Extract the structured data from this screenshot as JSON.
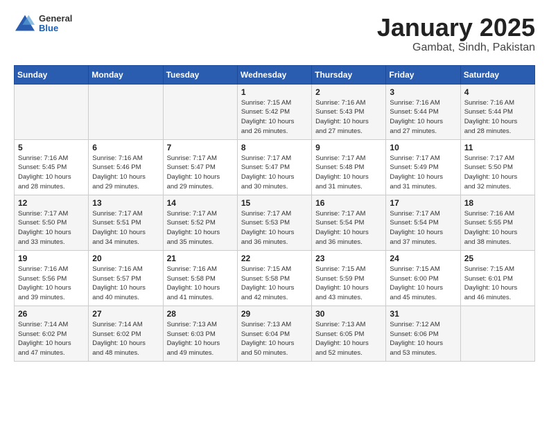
{
  "header": {
    "logo": {
      "general": "General",
      "blue": "Blue"
    },
    "title": "January 2025",
    "subtitle": "Gambat, Sindh, Pakistan"
  },
  "weekdays": [
    "Sunday",
    "Monday",
    "Tuesday",
    "Wednesday",
    "Thursday",
    "Friday",
    "Saturday"
  ],
  "weeks": [
    [
      {
        "day": "",
        "info": ""
      },
      {
        "day": "",
        "info": ""
      },
      {
        "day": "",
        "info": ""
      },
      {
        "day": "1",
        "info": "Sunrise: 7:15 AM\nSunset: 5:42 PM\nDaylight: 10 hours\nand 26 minutes."
      },
      {
        "day": "2",
        "info": "Sunrise: 7:16 AM\nSunset: 5:43 PM\nDaylight: 10 hours\nand 27 minutes."
      },
      {
        "day": "3",
        "info": "Sunrise: 7:16 AM\nSunset: 5:44 PM\nDaylight: 10 hours\nand 27 minutes."
      },
      {
        "day": "4",
        "info": "Sunrise: 7:16 AM\nSunset: 5:44 PM\nDaylight: 10 hours\nand 28 minutes."
      }
    ],
    [
      {
        "day": "5",
        "info": "Sunrise: 7:16 AM\nSunset: 5:45 PM\nDaylight: 10 hours\nand 28 minutes."
      },
      {
        "day": "6",
        "info": "Sunrise: 7:16 AM\nSunset: 5:46 PM\nDaylight: 10 hours\nand 29 minutes."
      },
      {
        "day": "7",
        "info": "Sunrise: 7:17 AM\nSunset: 5:47 PM\nDaylight: 10 hours\nand 29 minutes."
      },
      {
        "day": "8",
        "info": "Sunrise: 7:17 AM\nSunset: 5:47 PM\nDaylight: 10 hours\nand 30 minutes."
      },
      {
        "day": "9",
        "info": "Sunrise: 7:17 AM\nSunset: 5:48 PM\nDaylight: 10 hours\nand 31 minutes."
      },
      {
        "day": "10",
        "info": "Sunrise: 7:17 AM\nSunset: 5:49 PM\nDaylight: 10 hours\nand 31 minutes."
      },
      {
        "day": "11",
        "info": "Sunrise: 7:17 AM\nSunset: 5:50 PM\nDaylight: 10 hours\nand 32 minutes."
      }
    ],
    [
      {
        "day": "12",
        "info": "Sunrise: 7:17 AM\nSunset: 5:50 PM\nDaylight: 10 hours\nand 33 minutes."
      },
      {
        "day": "13",
        "info": "Sunrise: 7:17 AM\nSunset: 5:51 PM\nDaylight: 10 hours\nand 34 minutes."
      },
      {
        "day": "14",
        "info": "Sunrise: 7:17 AM\nSunset: 5:52 PM\nDaylight: 10 hours\nand 35 minutes."
      },
      {
        "day": "15",
        "info": "Sunrise: 7:17 AM\nSunset: 5:53 PM\nDaylight: 10 hours\nand 36 minutes."
      },
      {
        "day": "16",
        "info": "Sunrise: 7:17 AM\nSunset: 5:54 PM\nDaylight: 10 hours\nand 36 minutes."
      },
      {
        "day": "17",
        "info": "Sunrise: 7:17 AM\nSunset: 5:54 PM\nDaylight: 10 hours\nand 37 minutes."
      },
      {
        "day": "18",
        "info": "Sunrise: 7:16 AM\nSunset: 5:55 PM\nDaylight: 10 hours\nand 38 minutes."
      }
    ],
    [
      {
        "day": "19",
        "info": "Sunrise: 7:16 AM\nSunset: 5:56 PM\nDaylight: 10 hours\nand 39 minutes."
      },
      {
        "day": "20",
        "info": "Sunrise: 7:16 AM\nSunset: 5:57 PM\nDaylight: 10 hours\nand 40 minutes."
      },
      {
        "day": "21",
        "info": "Sunrise: 7:16 AM\nSunset: 5:58 PM\nDaylight: 10 hours\nand 41 minutes."
      },
      {
        "day": "22",
        "info": "Sunrise: 7:15 AM\nSunset: 5:58 PM\nDaylight: 10 hours\nand 42 minutes."
      },
      {
        "day": "23",
        "info": "Sunrise: 7:15 AM\nSunset: 5:59 PM\nDaylight: 10 hours\nand 43 minutes."
      },
      {
        "day": "24",
        "info": "Sunrise: 7:15 AM\nSunset: 6:00 PM\nDaylight: 10 hours\nand 45 minutes."
      },
      {
        "day": "25",
        "info": "Sunrise: 7:15 AM\nSunset: 6:01 PM\nDaylight: 10 hours\nand 46 minutes."
      }
    ],
    [
      {
        "day": "26",
        "info": "Sunrise: 7:14 AM\nSunset: 6:02 PM\nDaylight: 10 hours\nand 47 minutes."
      },
      {
        "day": "27",
        "info": "Sunrise: 7:14 AM\nSunset: 6:02 PM\nDaylight: 10 hours\nand 48 minutes."
      },
      {
        "day": "28",
        "info": "Sunrise: 7:13 AM\nSunset: 6:03 PM\nDaylight: 10 hours\nand 49 minutes."
      },
      {
        "day": "29",
        "info": "Sunrise: 7:13 AM\nSunset: 6:04 PM\nDaylight: 10 hours\nand 50 minutes."
      },
      {
        "day": "30",
        "info": "Sunrise: 7:13 AM\nSunset: 6:05 PM\nDaylight: 10 hours\nand 52 minutes."
      },
      {
        "day": "31",
        "info": "Sunrise: 7:12 AM\nSunset: 6:06 PM\nDaylight: 10 hours\nand 53 minutes."
      },
      {
        "day": "",
        "info": ""
      }
    ]
  ]
}
